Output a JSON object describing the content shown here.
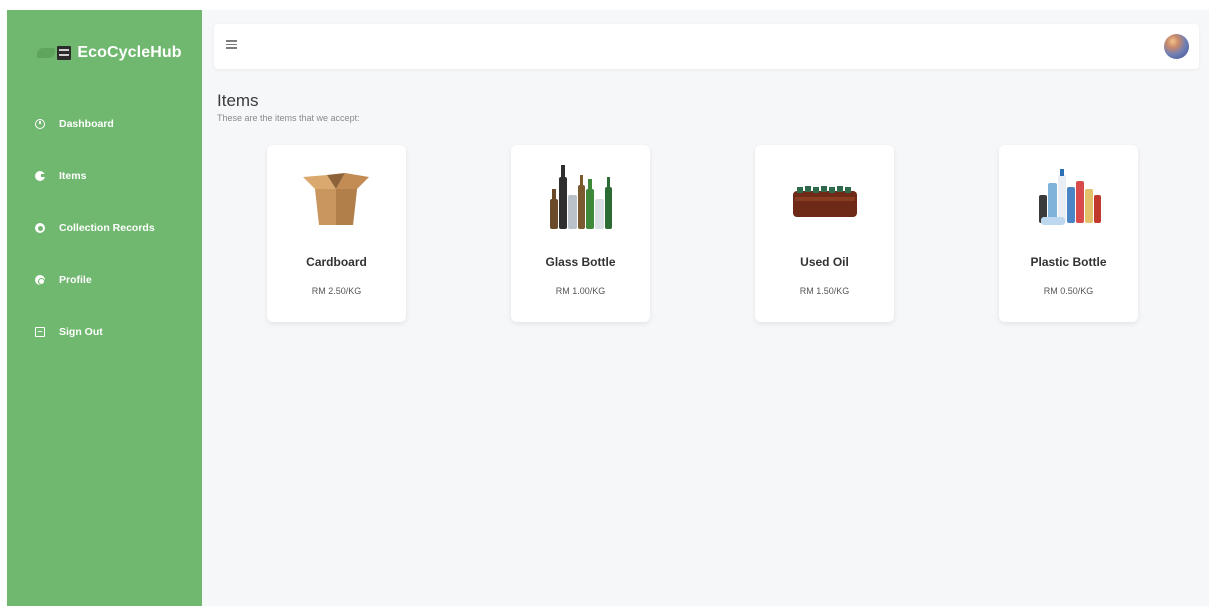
{
  "brand": {
    "name": "EcoCycleHub"
  },
  "sidebar": {
    "items": [
      {
        "label": "Dashboard",
        "icon": "dashboard-icon"
      },
      {
        "label": "Items",
        "icon": "pie-chart-icon"
      },
      {
        "label": "Collection Records",
        "icon": "dollar-icon"
      },
      {
        "label": "Profile",
        "icon": "user-icon"
      },
      {
        "label": "Sign Out",
        "icon": "sign-out-icon"
      }
    ]
  },
  "page": {
    "title": "Items",
    "subtitle": "These are the items that we accept:"
  },
  "items": [
    {
      "name": "Cardboard",
      "price": "RM 2.50/KG",
      "icon": "cardboard-box-icon"
    },
    {
      "name": "Glass Bottle",
      "price": "RM 1.00/KG",
      "icon": "glass-bottles-icon"
    },
    {
      "name": "Used Oil",
      "price": "RM 1.50/KG",
      "icon": "used-oil-bottles-icon"
    },
    {
      "name": "Plastic Bottle",
      "price": "RM 0.50/KG",
      "icon": "plastic-bottles-icon"
    }
  ],
  "colors": {
    "sidebar": "#70b86f",
    "background": "#f6f7f9",
    "card": "#ffffff"
  }
}
